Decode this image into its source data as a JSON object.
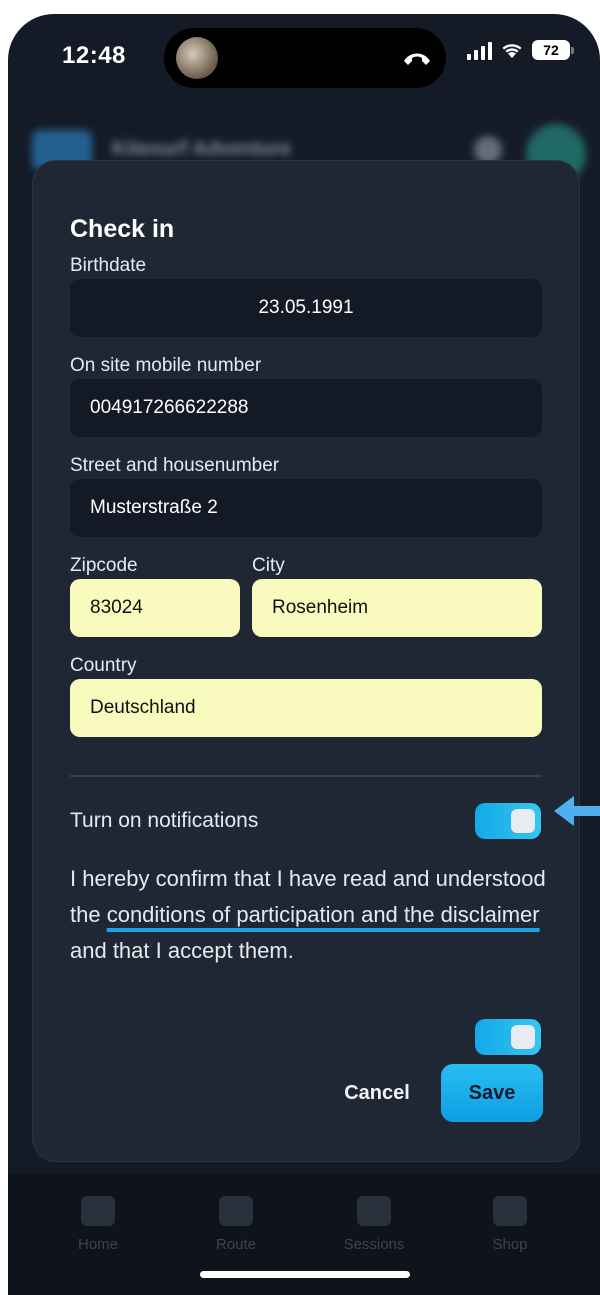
{
  "status_bar": {
    "time": "12:48",
    "battery": "72"
  },
  "background": {
    "header_title": "Kitesurf Adventure",
    "nav_items": [
      "Home",
      "Route",
      "Sessions",
      "Shop"
    ]
  },
  "modal": {
    "title": "Check in",
    "fields": {
      "birthdate": {
        "label": "Birthdate",
        "value": "23.05.1991"
      },
      "mobile": {
        "label": "On site mobile number",
        "value": "004917266622288"
      },
      "street": {
        "label": "Street and housenumber",
        "value": "Musterstraße 2"
      },
      "zipcode": {
        "label": "Zipcode",
        "value": "83024"
      },
      "city": {
        "label": "City",
        "value": "Rosenheim"
      },
      "country": {
        "label": "Country",
        "value": "Deutschland"
      }
    },
    "notifications_label": "Turn on notifications",
    "notifications_on": true,
    "confirm_before": "I hereby confirm that I have read and understood the ",
    "confirm_link": "conditions of participation and the disclaimer",
    "confirm_after": " and that I accept them.",
    "confirm_on": true,
    "cancel_label": "Cancel",
    "save_label": "Save"
  },
  "colors": {
    "accent": "#1aa3e5",
    "modal_bg": "#1f2735",
    "input_bg": "#131a26",
    "autofill_bg": "#f8fbbd",
    "annotation_arrow": "#4fb0ee"
  }
}
